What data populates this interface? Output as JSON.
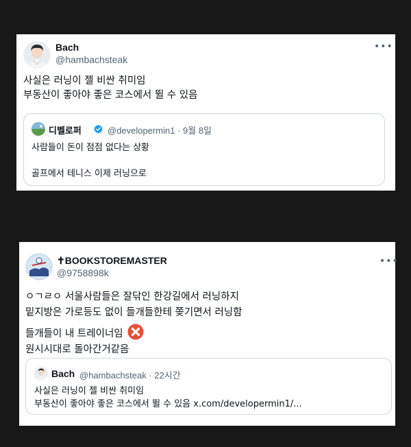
{
  "tweet1": {
    "author_name": "Bach",
    "author_handle": "@hambachsteak",
    "more_icon": "ellipsis-icon",
    "lines": [
      "사실은 러닝이 젤 비싼 취미임",
      "부동산이 좋아야 좋은 코스에서 뛸 수 있음"
    ],
    "quote": {
      "author_name": "디벨로퍼",
      "meta": "@developermin1 · 9월 8일",
      "lines": [
        "사람들이 돈이 점점 없다는 상황",
        "",
        "골프에서 테니스 이제 러닝으로"
      ]
    }
  },
  "tweet2": {
    "author_name": "✝BOOKSTOREMASTER",
    "author_handle": "@9758898k",
    "more_icon": "ellipsis-icon",
    "lines": [
      "ㅇㄱㄹㅇ 서울사람들은 잘닦인 한강길에서 러닝하지",
      "밑지방은 가로등도 없이 들개들한테 쫒기면서 러닝함",
      "들개들이 내 트레이너임",
      "원시시대로 돌아간거같음"
    ],
    "quote": {
      "author_name": "Bach",
      "meta": "@hambachsteak · 22시간",
      "lines": [
        "사실은 러닝이 젤 비싼 취미임",
        "부동산이 좋아야 좋은 코스에서 뛸 수 있음 x.com/developermin1/..."
      ]
    }
  },
  "colors": {
    "background": "#181818",
    "card": "#ffffff",
    "verified_badge": "#1d9bf0",
    "cross_emoji": "#e0523a"
  }
}
